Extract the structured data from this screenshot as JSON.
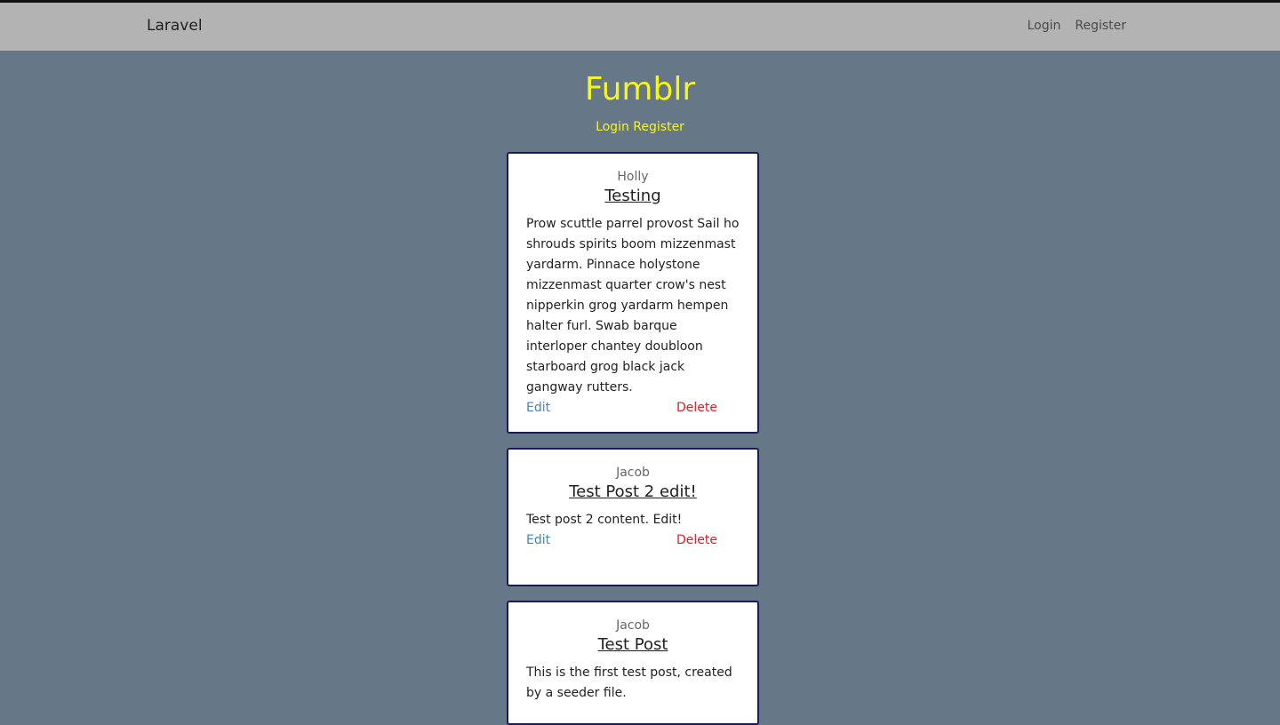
{
  "navbar": {
    "brand": "Laravel",
    "links": [
      "Login",
      "Register"
    ]
  },
  "header": {
    "title": "Fumblr",
    "links": [
      "Login",
      "Register"
    ]
  },
  "posts": [
    {
      "author": "Holly",
      "title": "Testing",
      "body": "Prow scuttle parrel provost Sail ho shrouds spirits boom mizzenmast yardarm. Pinnace holystone mizzenmast quarter crow's nest nipperkin grog yardarm hempen halter furl. Swab barque interloper chantey doubloon starboard grog black jack gangway rutters.",
      "edit_label": "Edit",
      "delete_label": "Delete"
    },
    {
      "author": "Jacob",
      "title": "Test Post 2 edit!",
      "body": "Test post 2 content. Edit!",
      "edit_label": "Edit",
      "delete_label": "Delete"
    },
    {
      "author": "Jacob",
      "title": "Test Post",
      "body": "This is the first test post, created by a seeder file."
    }
  ],
  "colors": {
    "page_background": "#667788",
    "navbar_background": "#b3b3b3",
    "title_yellow": "#f6f61e",
    "card_border": "#1a1a5e",
    "edit_link": "#3e86c0",
    "delete_link": "#d8202a"
  }
}
